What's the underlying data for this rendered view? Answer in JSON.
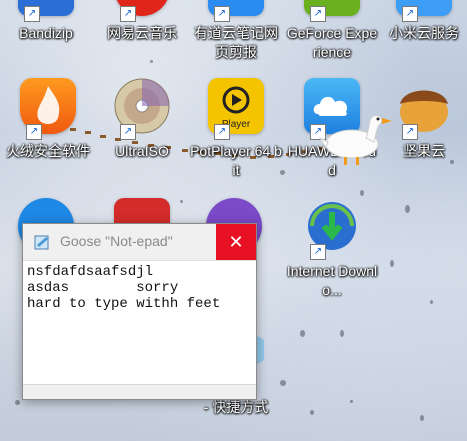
{
  "desktop": {
    "icons": [
      {
        "label": "Bandizip",
        "icon": "bandizip-icon"
      },
      {
        "label": "网易云音乐",
        "icon": "netease-music-icon"
      },
      {
        "label": "有道云笔记网页剪报",
        "icon": "youdao-note-icon"
      },
      {
        "label": "GeForce Experience",
        "icon": "geforce-icon"
      },
      {
        "label": "小米云服务",
        "icon": "mi-cloud-icon"
      },
      {
        "label": "火绒安全软件",
        "icon": "huorong-icon"
      },
      {
        "label": "UltraISO",
        "icon": "ultraiso-icon"
      },
      {
        "label": "PotPlayer 64 bit",
        "icon": "potplayer-icon"
      },
      {
        "label": "HUAWEI Cloud",
        "icon": "huawei-cloud-icon"
      },
      {
        "label": "坚果云",
        "icon": "jianguoyun-icon"
      },
      {
        "label": "Internet Downlo...",
        "icon": "idm-icon"
      },
      {
        "label": "- 快捷方式",
        "icon": "shortcut-icon"
      }
    ]
  },
  "notepad": {
    "title": "Goose \"Not-epad\"",
    "close": "✕",
    "lines": [
      "nsfdafdsaafsdjl",
      "asdas        sorry",
      "hard to type withh feet"
    ]
  },
  "colors": {
    "close_red": "#e81123",
    "goose_beak": "#f39a1a"
  }
}
